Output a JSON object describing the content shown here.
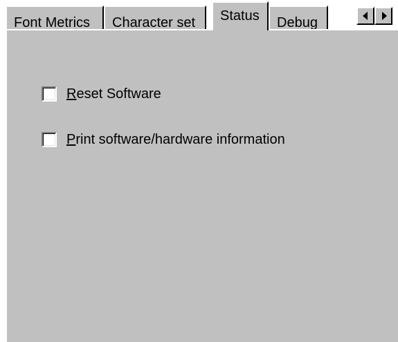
{
  "tabs": [
    {
      "label": "Font Metrics",
      "active": false
    },
    {
      "label": "Character set",
      "active": false
    },
    {
      "label": "Status",
      "active": true
    },
    {
      "label": "Debug",
      "active": false
    }
  ],
  "tab_scroll": {
    "left_icon": "arrow-left-icon",
    "right_icon": "arrow-right-icon"
  },
  "options": [
    {
      "mnemonic": "R",
      "rest": "eset Software",
      "checked": false
    },
    {
      "mnemonic": "P",
      "rest": "rint software/hardware information",
      "checked": false
    }
  ],
  "colors": {
    "face": "#c0c0c0",
    "highlight": "#ffffff",
    "shadow": "#808080",
    "dark": "#000000"
  }
}
